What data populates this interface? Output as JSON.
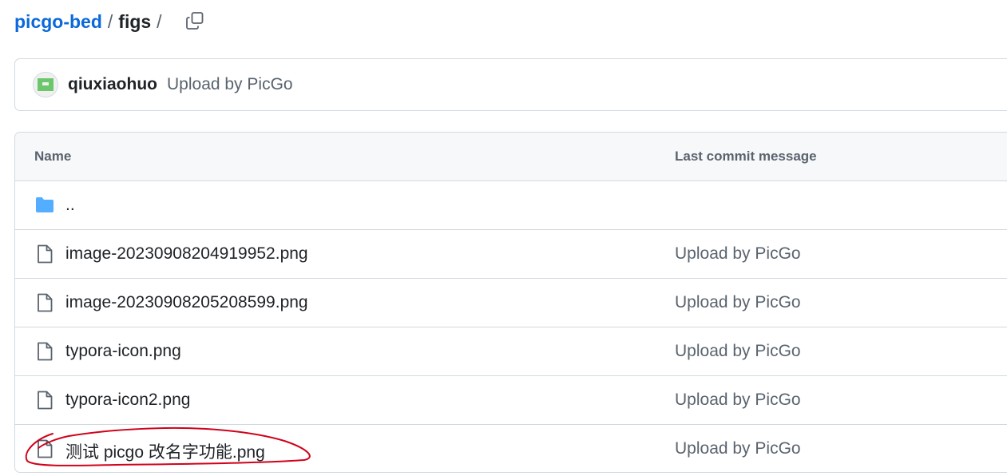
{
  "breadcrumb": {
    "repo": "picgo-bed",
    "separator": "/",
    "folder": "figs",
    "trailing_separator": "/"
  },
  "icons": {
    "copy_path": "copy-icon",
    "folder": "folder-icon",
    "file": "file-icon",
    "avatar": "identicon-avatar"
  },
  "latest_commit": {
    "author": "qiuxiaohuo",
    "message": "Upload by PicGo"
  },
  "table": {
    "headers": {
      "name": "Name",
      "message": "Last commit message"
    },
    "parent_dir": {
      "name": "..",
      "message": ""
    },
    "files": [
      {
        "name": "image-20230908204919952.png",
        "message": "Upload by PicGo"
      },
      {
        "name": "image-20230908205208599.png",
        "message": "Upload by PicGo"
      },
      {
        "name": "typora-icon.png",
        "message": "Upload by PicGo"
      },
      {
        "name": "typora-icon2.png",
        "message": "Upload by PicGo"
      },
      {
        "name": "测试 picgo 改名字功能.png",
        "message": "Upload by PicGo"
      }
    ]
  },
  "colors": {
    "link": "#0969da",
    "muted": "#59636e",
    "border": "#d1d9e0",
    "header_bg": "#f6f8fa",
    "folder": "#54aeff",
    "avatar": "#6cc66c",
    "annotation": "#d0021b"
  }
}
